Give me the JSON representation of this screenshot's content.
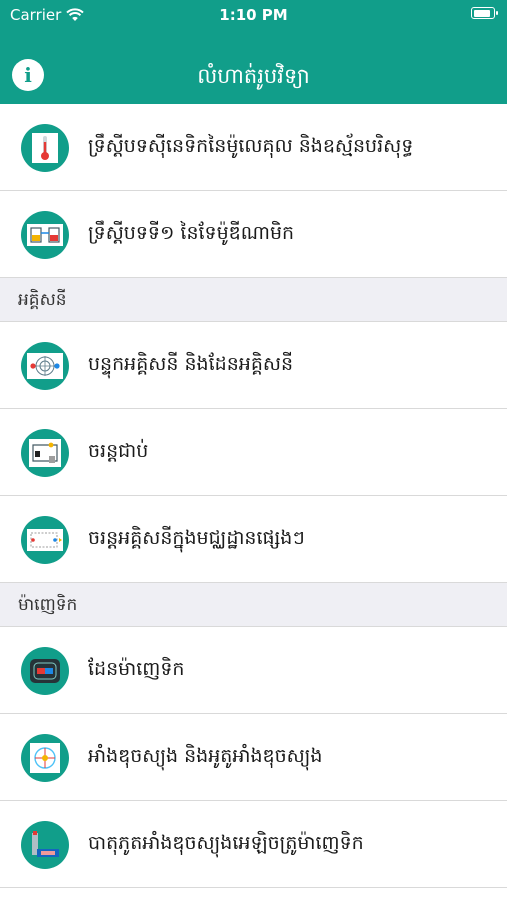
{
  "status_bar": {
    "carrier": "Carrier",
    "time": "1:10 PM",
    "battery_level": 0.9
  },
  "nav": {
    "title": "លំហាត់រូបវិទ្យា",
    "info_label": "i"
  },
  "colors": {
    "accent": "#119e8a",
    "section_bg": "#efeff4"
  },
  "list": {
    "group1": [
      {
        "label": "ទ្រឹស្តីបទស៊ីនេទិកនៃម៉ូលេគុល និងឧស្ម័នបរិសុទ្ធ",
        "icon": "thermometer-icon"
      },
      {
        "label": "ទ្រឹស្តីបទទី១ នៃទែម៉ូឌីណាមិក",
        "icon": "engine-diagram-icon"
      }
    ],
    "section2": {
      "title": "អគ្គិសនី"
    },
    "group2": [
      {
        "label": "បន្ទុកអគ្គិសនី និងដែនអគ្គិសនី",
        "icon": "electric-field-icon"
      },
      {
        "label": "ចរន្តជាប់",
        "icon": "circuit-icon"
      },
      {
        "label": "ចរន្តអគ្គិសនីក្នុងមជ្ឈដ្ឋានផ្សេងៗ",
        "icon": "current-medium-icon"
      }
    ],
    "section3": {
      "title": "ម៉ាញេទិក"
    },
    "group3": [
      {
        "label": "ដែនម៉ាញេទិក",
        "icon": "magnet-field-icon"
      },
      {
        "label": "អាំងឌុចស្យុង និងអូតូអាំងឌុចស្យុង",
        "icon": "induction-coil-icon"
      },
      {
        "label": "បាតុភូតអាំងឌុចស្យុងអេឡិចត្រូម៉ាញេទិក",
        "icon": "electromagnetic-icon"
      }
    ]
  }
}
